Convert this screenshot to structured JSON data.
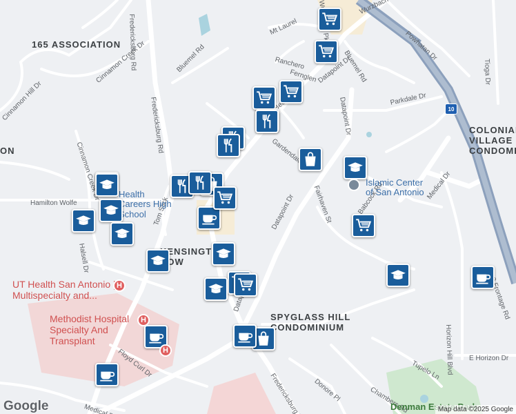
{
  "map": {
    "attribution": "Map data ©2025 Google",
    "logo_text": "Google",
    "streets": [
      {
        "text": "Wurzbach Rd",
        "rot": -25
      },
      {
        "text": "Fredericksburg Rd",
        "rot": 88
      },
      {
        "text": "Fredericksburg Rd",
        "rot": 82
      },
      {
        "text": "Fredericksburg Rd",
        "rot": 58
      },
      {
        "text": "Bluemel Rd",
        "rot": -45
      },
      {
        "text": "Cinnamon Creek Dr",
        "rot": -40
      },
      {
        "text": "Cinnamon Hill Dr",
        "rot": -45
      },
      {
        "text": "Cinnamon Creek Dr",
        "rot": 72
      },
      {
        "text": "Hamilton Wolfe",
        "rot": 0
      },
      {
        "text": "Tom Slick",
        "rot": -70
      },
      {
        "text": "Halsell Dr",
        "rot": 80
      },
      {
        "text": "Mt Laurel",
        "rot": -25
      },
      {
        "text": "Ranchero",
        "rot": 15
      },
      {
        "text": "Fernglen",
        "rot": 18
      },
      {
        "text": "Datapoint Dr",
        "rot": -38
      },
      {
        "text": "Datapoint Dr",
        "rot": 80
      },
      {
        "text": "Datapoint Dr",
        "rot": -62
      },
      {
        "text": "Datapoint Dr",
        "rot": -72
      },
      {
        "text": "Bluemel Rd",
        "rot": 58
      },
      {
        "text": "Powhatan Dr",
        "rot": 42
      },
      {
        "text": "Tioga Dr",
        "rot": 88
      },
      {
        "text": "Parkdale Dr",
        "rot": -12
      },
      {
        "text": "Gardendale",
        "rot": 38
      },
      {
        "text": "Fairhaven St",
        "rot": 70
      },
      {
        "text": "Babcock Rd",
        "rot": -55
      },
      {
        "text": "Medical Dr",
        "rot": -52
      },
      {
        "text": "Horizon Hill Blvd",
        "rot": 88
      },
      {
        "text": "E Horizon Dr",
        "rot": 0
      },
      {
        "text": "Tupelo Ln",
        "rot": 30
      },
      {
        "text": "Chambers Rd",
        "rot": 32
      },
      {
        "text": "Donore Pl",
        "rot": 40
      },
      {
        "text": "Floyd Curl Dr",
        "rot": 38
      },
      {
        "text": "Medical Dr",
        "rot": 20
      },
      {
        "text": "Wurzbach Pkwy",
        "rot": 83
      },
      {
        "text": "I-10 Frontage Rd",
        "rot": 70
      },
      {
        "text": "Bee",
        "rot": -40
      }
    ],
    "areas": [
      "165 ASSOCIATION",
      "COLONIAL VILLAGE CONDOMINIUMS",
      "KENSINGTON ROW",
      "SPYGLASS HILL CONDOMINIUM",
      "ON",
      "Denman Estate Park"
    ],
    "poi_labels": [
      "Health Careers High School",
      "Islamic Center of San Antonio"
    ],
    "hospital_labels": [
      "UT Health San Antonio | Multispecialty and...",
      "Methodist Hospital Specialty And Transplant"
    ],
    "highway_shield": "10",
    "pins": [
      {
        "type": "grocery"
      },
      {
        "type": "grocery"
      },
      {
        "type": "grocery"
      },
      {
        "type": "grocery"
      },
      {
        "type": "grocery"
      },
      {
        "type": "restaurant"
      },
      {
        "type": "restaurant"
      },
      {
        "type": "restaurant"
      },
      {
        "type": "shopping"
      },
      {
        "type": "school"
      },
      {
        "type": "school"
      },
      {
        "type": "school"
      },
      {
        "type": "school"
      },
      {
        "type": "school"
      },
      {
        "type": "restaurant"
      },
      {
        "type": "shopping"
      },
      {
        "type": "restaurant"
      },
      {
        "type": "cafe"
      },
      {
        "type": "grocery"
      },
      {
        "type": "school"
      },
      {
        "type": "school"
      },
      {
        "type": "grocery"
      },
      {
        "type": "grocery"
      },
      {
        "type": "school"
      },
      {
        "type": "school"
      },
      {
        "type": "cafe"
      },
      {
        "type": "shopping"
      },
      {
        "type": "grocery"
      },
      {
        "type": "school"
      },
      {
        "type": "cafe"
      },
      {
        "type": "cafe"
      },
      {
        "type": "cafe"
      }
    ]
  }
}
